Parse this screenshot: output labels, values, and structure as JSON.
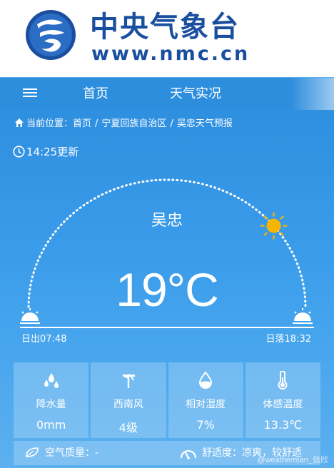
{
  "header": {
    "site_name": "中央气象台",
    "site_url": "www.nmc.cn"
  },
  "nav": {
    "home": "首页",
    "live": "天气实况"
  },
  "breadcrumb": {
    "prefix": "当前位置：",
    "items": [
      "首页",
      "宁夏回族自治区",
      "吴忠天气预报"
    ],
    "separator": "/"
  },
  "update_time": "14:25更新",
  "weather": {
    "city": "吴忠",
    "temperature": "19°C",
    "sunrise": "日出07:48",
    "sunset": "日落18:32",
    "sun_progress": 0.78
  },
  "cards": [
    {
      "icon": "rain-drops-icon",
      "label": "降水量",
      "value": "0mm"
    },
    {
      "icon": "wind-vane-icon",
      "label": "西南风",
      "value": "4级"
    },
    {
      "icon": "humidity-drop-icon",
      "label": "相对湿度",
      "value": "7%"
    },
    {
      "icon": "thermometer-icon",
      "label": "体感温度",
      "value": "13.3℃"
    }
  ],
  "air_quality": "空气质量：-",
  "comfort": "舒适度：凉爽，较舒适",
  "watermark": "@weatherman_信欣",
  "colors": {
    "brand_blue": "#1a4fa0",
    "nav_blue": "#2e8ede",
    "sun": "#f7b500"
  }
}
